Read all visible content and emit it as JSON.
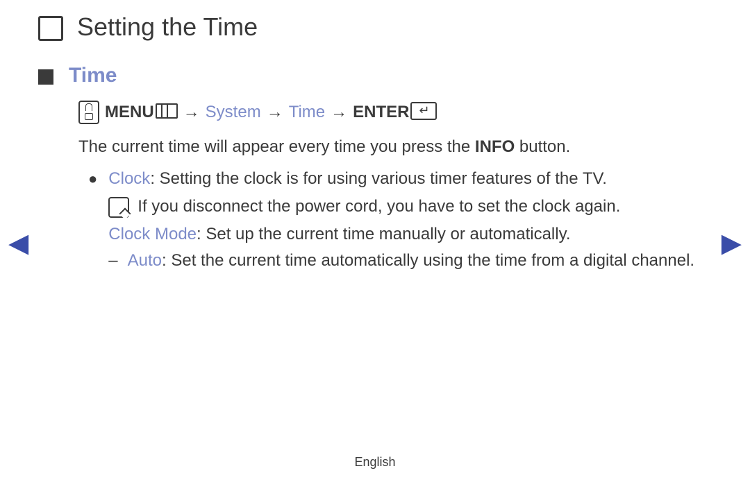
{
  "header": {
    "title": "Setting the Time"
  },
  "section": {
    "title": "Time"
  },
  "path": {
    "menu_label": "MENU",
    "system": "System",
    "time": "Time",
    "enter_label": "ENTER",
    "sep": "→"
  },
  "intro": {
    "pre": "The current time will appear every time you press the ",
    "bold": "INFO",
    "post": " button."
  },
  "clock": {
    "label": "Clock",
    "text": ": Setting the clock is for using various timer features of the TV."
  },
  "note": {
    "text": "If you disconnect the power cord, you have to set the clock again."
  },
  "clock_mode": {
    "label": "Clock Mode",
    "text": ": Set up the current time manually or automatically."
  },
  "auto": {
    "label": "Auto",
    "text": ": Set the current time automatically using the time from a digital channel."
  },
  "footer": {
    "lang": "English"
  }
}
